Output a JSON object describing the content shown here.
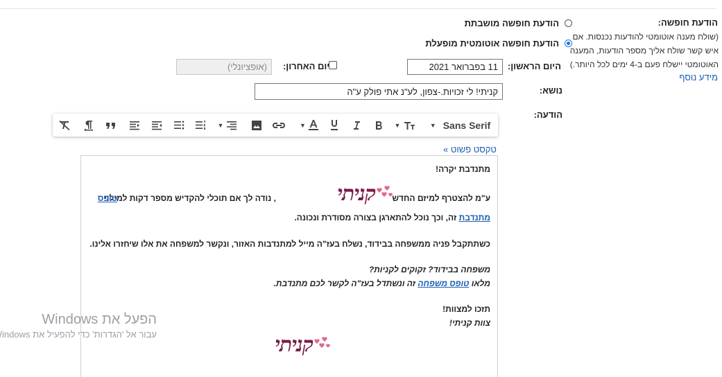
{
  "vacation": {
    "label": "הודעת חופשה:",
    "help": "(שולח מענה אוטומטי להודעות נכנסות. אם איש קשר שולח אליך מספר הודעות, המענה האוטומטי יישלח פעם ב-4 ימים לכל היותר.)",
    "more_link": "מידע נוסף",
    "option_off": "הודעת חופשה מושבתת",
    "option_on": "הודעת חופשה אוטומטית מופעלת",
    "selected": "on"
  },
  "dates": {
    "first_label": "היום הראשון:",
    "first_value": "11 בפברואר 2021",
    "last_label": "היום האחרון:",
    "last_placeholder": "(אופציונלי)",
    "last_checked": false
  },
  "subject": {
    "label": "נושא:",
    "value": "קניתי! לי זכויות.-צפון, לע\"נ אתי פולק ע\"ה"
  },
  "message": {
    "label": "הודעה:",
    "plain_text_link": "« טקסט פשוט",
    "toolbar": {
      "font": "Sans Serif",
      "icons": [
        "font-size-icon",
        "bold-icon",
        "italic-icon",
        "underline-icon",
        "text-color-icon",
        "link-icon",
        "image-icon",
        "align-icon",
        "numbered-list-icon",
        "bulleted-list-icon",
        "indent-less-icon",
        "indent-more-icon",
        "quote-icon",
        "rtl-icon",
        "remove-formatting-icon"
      ]
    },
    "body": {
      "greeting": "מתנדבת יקרה!",
      "line1_start": "ע\"מ להצטרף למיזם החדש",
      "logo_text": "קניתי",
      "line1_end": ", נודה לך אם תוכלי להקדיש מספר דקות למילוי",
      "form_link": "טופס",
      "line2_link": "מתנדבת",
      "line2_rest": "זה, וכך נוכל להתארגן בצורה מסודרת ונכונה.",
      "para2": "כשתתקבל פניה ממשפחה בבידוד, נשלח בעז\"ה מייל למתנדבות האזור, ונקשר למשפחה את אלו שיחזרו אלינו.",
      "q": "משפחה בבידוד? זקוקים לקניות?",
      "fill_start": "מלאו",
      "family_link": "טופס משפחה",
      "fill_end": "זה ונשתדל בעז\"ה לקשר לכם מתנדבת.",
      "thanks": "תזכו למצוות!",
      "team": "צוות קניתי!"
    }
  },
  "watermark": {
    "title": "הפעל את Windows",
    "subtitle": "עבור אל 'הגדרות' כדי להפעיל את Windows"
  },
  "colors": {
    "link": "#1a5fb4",
    "logo": "#7a1b4a",
    "hearts": "#e06b8f",
    "radio_accent": "#1a73e8"
  }
}
